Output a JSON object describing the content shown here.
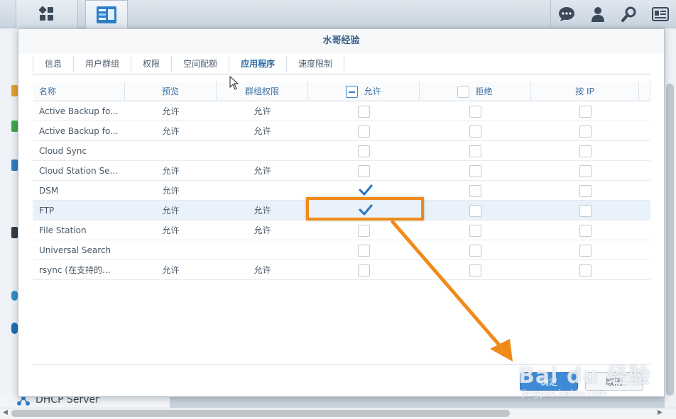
{
  "dialog": {
    "title": "水哥经验",
    "tabs": [
      "信息",
      "用户群组",
      "权限",
      "空间配额",
      "应用程序",
      "速度限制"
    ],
    "active_tab": "应用程序",
    "ok_label": "确定",
    "cancel_label": "取消"
  },
  "grid": {
    "columns": {
      "name": "名称",
      "preview": "预览",
      "group_permission": "群组权限",
      "allow": "允许",
      "deny": "拒绝",
      "by_ip": "按 IP"
    },
    "rows": [
      {
        "name": "Active Backup fo...",
        "preview": "允许",
        "group": "允许",
        "allow": false,
        "deny": false,
        "ip": false
      },
      {
        "name": "Active Backup fo...",
        "preview": "允许",
        "group": "允许",
        "allow": false,
        "deny": false,
        "ip": false
      },
      {
        "name": "Cloud Sync",
        "preview": "",
        "group": "",
        "allow": false,
        "deny": false,
        "ip": false
      },
      {
        "name": "Cloud Station Se...",
        "preview": "允许",
        "group": "允许",
        "allow": false,
        "deny": false,
        "ip": false
      },
      {
        "name": "DSM",
        "preview": "允许",
        "group": "",
        "allow": true,
        "deny": false,
        "ip": false
      },
      {
        "name": "FTP",
        "preview": "允许",
        "group": "允许",
        "allow": true,
        "deny": false,
        "ip": false,
        "selected": true
      },
      {
        "name": "File Station",
        "preview": "允许",
        "group": "允许",
        "allow": false,
        "deny": false,
        "ip": false
      },
      {
        "name": "Universal Search",
        "preview": "",
        "group": "",
        "allow": false,
        "deny": false,
        "ip": false
      },
      {
        "name": "rsync (在支持的...",
        "preview": "允许",
        "group": "允许",
        "allow": false,
        "deny": false,
        "ip": false
      }
    ]
  },
  "background": {
    "dhcp_label": "DHCP Server"
  },
  "watermark": {
    "main": "Bai du 经验",
    "sub": "jingyan.baidu.com"
  },
  "colors": {
    "accent": "#3d8ad6",
    "highlight": "#f08a18",
    "check": "#2e7cc5"
  }
}
